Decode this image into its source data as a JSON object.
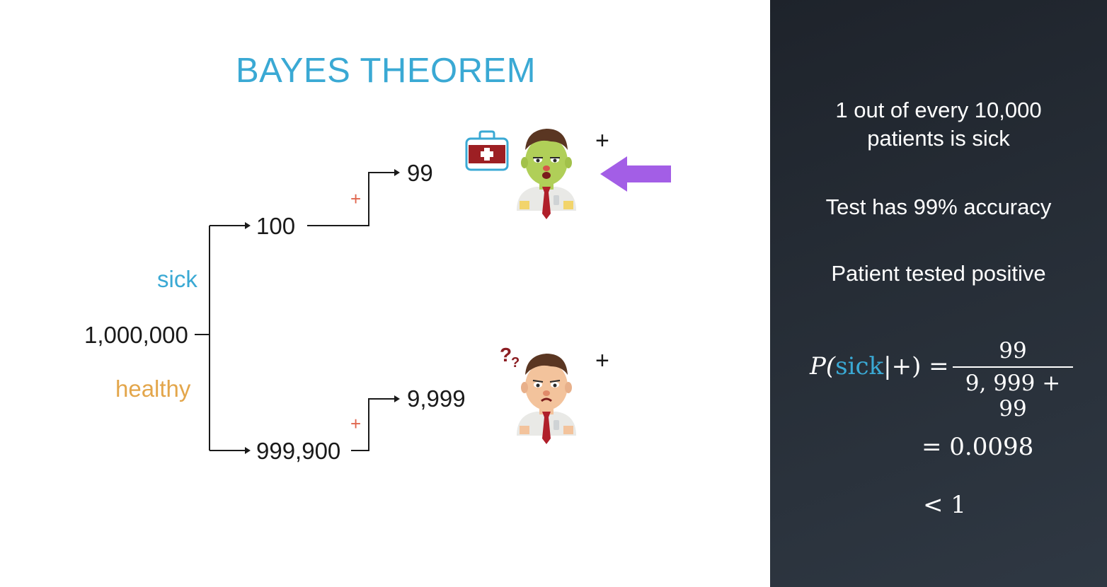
{
  "title": "BAYES THEOREM",
  "tree": {
    "root": "1,000,000",
    "branch_sick_label": "sick",
    "branch_healthy_label": "healthy",
    "sick_count": "100",
    "healthy_count": "999,900",
    "sick_positive": "99",
    "healthy_positive": "9,999",
    "test_positive_symbol": "+",
    "plus_mark": "+"
  },
  "icons": {
    "sick_person": "sick-doctor-icon",
    "healthy_person": "confused-doctor-icon",
    "first_aid": "first-aid-kit-icon",
    "question_marks": "?",
    "question_marks_small": "?",
    "arrow": "purple-arrow-icon"
  },
  "facts": {
    "line1": "1 out of every 10,000",
    "line2": "patients is sick",
    "accuracy": "Test has 99% accuracy",
    "result": "Patient tested positive"
  },
  "formula": {
    "p_open": "P(",
    "sick": "sick",
    "given": "|+) =",
    "numerator": "99",
    "denominator": "9, 999 + 99",
    "equals": "= 0.0098",
    "less": "< 1"
  },
  "colors": {
    "accent_blue": "#3aa9d4",
    "healthy_orange": "#e3a64b",
    "plus_red": "#e0664e",
    "arrow_purple": "#a35ee6",
    "panel_dark": "#262d36"
  }
}
